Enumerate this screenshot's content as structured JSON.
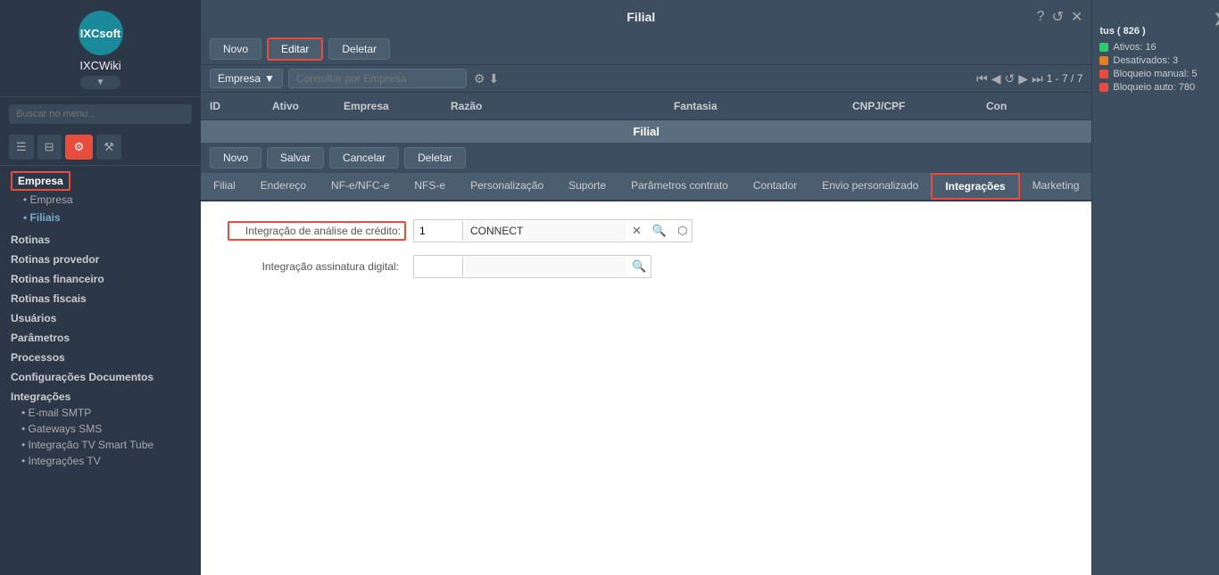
{
  "sidebar": {
    "logo_text": "IXCWiki",
    "logo_abbr": "IXCsoft",
    "logo_btn": "▼",
    "search_placeholder": "Buscar no menu...",
    "icons": [
      {
        "name": "list-icon",
        "symbol": "☰",
        "active": false
      },
      {
        "name": "print-icon",
        "symbol": "🖨",
        "active": false
      },
      {
        "name": "gear-icon",
        "symbol": "⚙",
        "active": true
      },
      {
        "name": "wrench-icon",
        "symbol": "🔧",
        "active": false
      }
    ],
    "empresa_section": {
      "title": "Empresa",
      "items": [
        {
          "label": "Empresa",
          "active": false
        },
        {
          "label": "Filiais",
          "active": true
        }
      ]
    },
    "groups": [
      {
        "title": "Rotinas",
        "items": []
      },
      {
        "title": "Rotinas provedor",
        "items": []
      },
      {
        "title": "Rotinas financeiro",
        "items": []
      },
      {
        "title": "Rotinas fiscais",
        "items": []
      },
      {
        "title": "Usuários",
        "items": []
      },
      {
        "title": "Parâmetros",
        "items": []
      },
      {
        "title": "Processos",
        "items": []
      },
      {
        "title": "Configurações Documentos",
        "items": []
      },
      {
        "title": "Integrações",
        "items": [
          {
            "label": "E-mail SMTP"
          },
          {
            "label": "Gateways SMS"
          },
          {
            "label": "Integração TV Smart Tube"
          },
          {
            "label": "Integrações TV"
          }
        ]
      }
    ]
  },
  "topbar": {
    "title": "Filial",
    "help_btn": "?",
    "refresh_btn": "↺",
    "close_btn": "✕",
    "collapse_btn": "❮",
    "external_btn": "⬡"
  },
  "toolbar": {
    "novo_label": "Novo",
    "editar_label": "Editar",
    "deletar_label": "Deletar"
  },
  "filterbar": {
    "empresa_label": "Empresa",
    "placeholder": "Consultar por Empresa",
    "pagination": "1 - 7 / 7"
  },
  "table": {
    "columns": [
      "ID",
      "Ativo",
      "Empresa",
      "Razão",
      "Fantasia",
      "CNPJ/CPF",
      "Con"
    ]
  },
  "inner": {
    "title": "Filial",
    "novo_label": "Novo",
    "salvar_label": "Salvar",
    "cancelar_label": "Cancelar",
    "deletar_label": "Deletar",
    "tabs": [
      {
        "label": "Filial",
        "active": false
      },
      {
        "label": "Endereço",
        "active": false
      },
      {
        "label": "NF-e/NFC-e",
        "active": false
      },
      {
        "label": "NFS-e",
        "active": false
      },
      {
        "label": "Personalização",
        "active": false
      },
      {
        "label": "Suporte",
        "active": false
      },
      {
        "label": "Parâmetros contrato",
        "active": false
      },
      {
        "label": "Contador",
        "active": false
      },
      {
        "label": "Envio personalizado",
        "active": false
      },
      {
        "label": "Integrações",
        "active": true
      },
      {
        "label": "Marketing",
        "active": false
      }
    ],
    "fields": {
      "integracao_credito_label": "Integração de análise de crédito:",
      "integracao_credito_id": "1",
      "integracao_credito_value": "CONNECT",
      "integracao_assinatura_label": "Integração assinatura digital:",
      "integracao_assinatura_id": "",
      "integracao_assinatura_value": ""
    }
  },
  "right_panel": {
    "title": "tus ( 826 )",
    "status_items": [
      {
        "label": "Ativos: 16",
        "color": "green"
      },
      {
        "label": "Desativados: 3",
        "color": "orange"
      },
      {
        "label": "Bloqueio manual: 5",
        "color": "red"
      },
      {
        "label": "Bloqueio auto: 780",
        "color": "red"
      }
    ]
  }
}
